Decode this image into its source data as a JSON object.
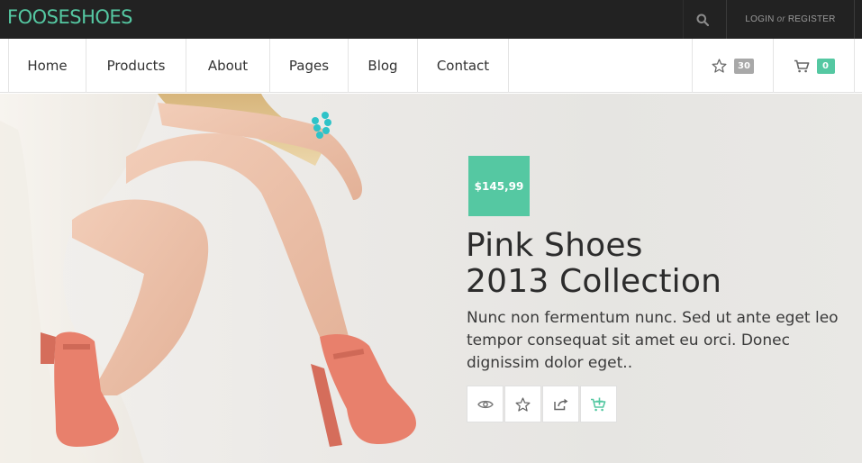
{
  "brand": {
    "logo": "FOOSESHOES",
    "accent": "#55c8a2"
  },
  "topbar": {
    "search_icon": "search-icon",
    "login": "LOGIN",
    "or": "or",
    "register": "REGISTER"
  },
  "nav": {
    "items": [
      {
        "label": "Home"
      },
      {
        "label": "Products"
      },
      {
        "label": "About"
      },
      {
        "label": "Pages"
      },
      {
        "label": "Blog"
      },
      {
        "label": "Contact"
      }
    ],
    "wishlist": {
      "icon": "star-icon",
      "count": "30"
    },
    "cart": {
      "icon": "cart-icon",
      "count": "0"
    }
  },
  "hero": {
    "price": "$145,99",
    "title_line1": "Pink Shoes",
    "title_line2": "2013 Collection",
    "description": "Nunc non fermentum nunc. Sed ut ante eget leo tempor consequat sit amet eu orci. Donec dignissim dolor eget..",
    "actions": [
      {
        "icon": "eye-icon"
      },
      {
        "icon": "star-icon"
      },
      {
        "icon": "share-icon"
      },
      {
        "icon": "add-to-cart-icon"
      }
    ]
  }
}
